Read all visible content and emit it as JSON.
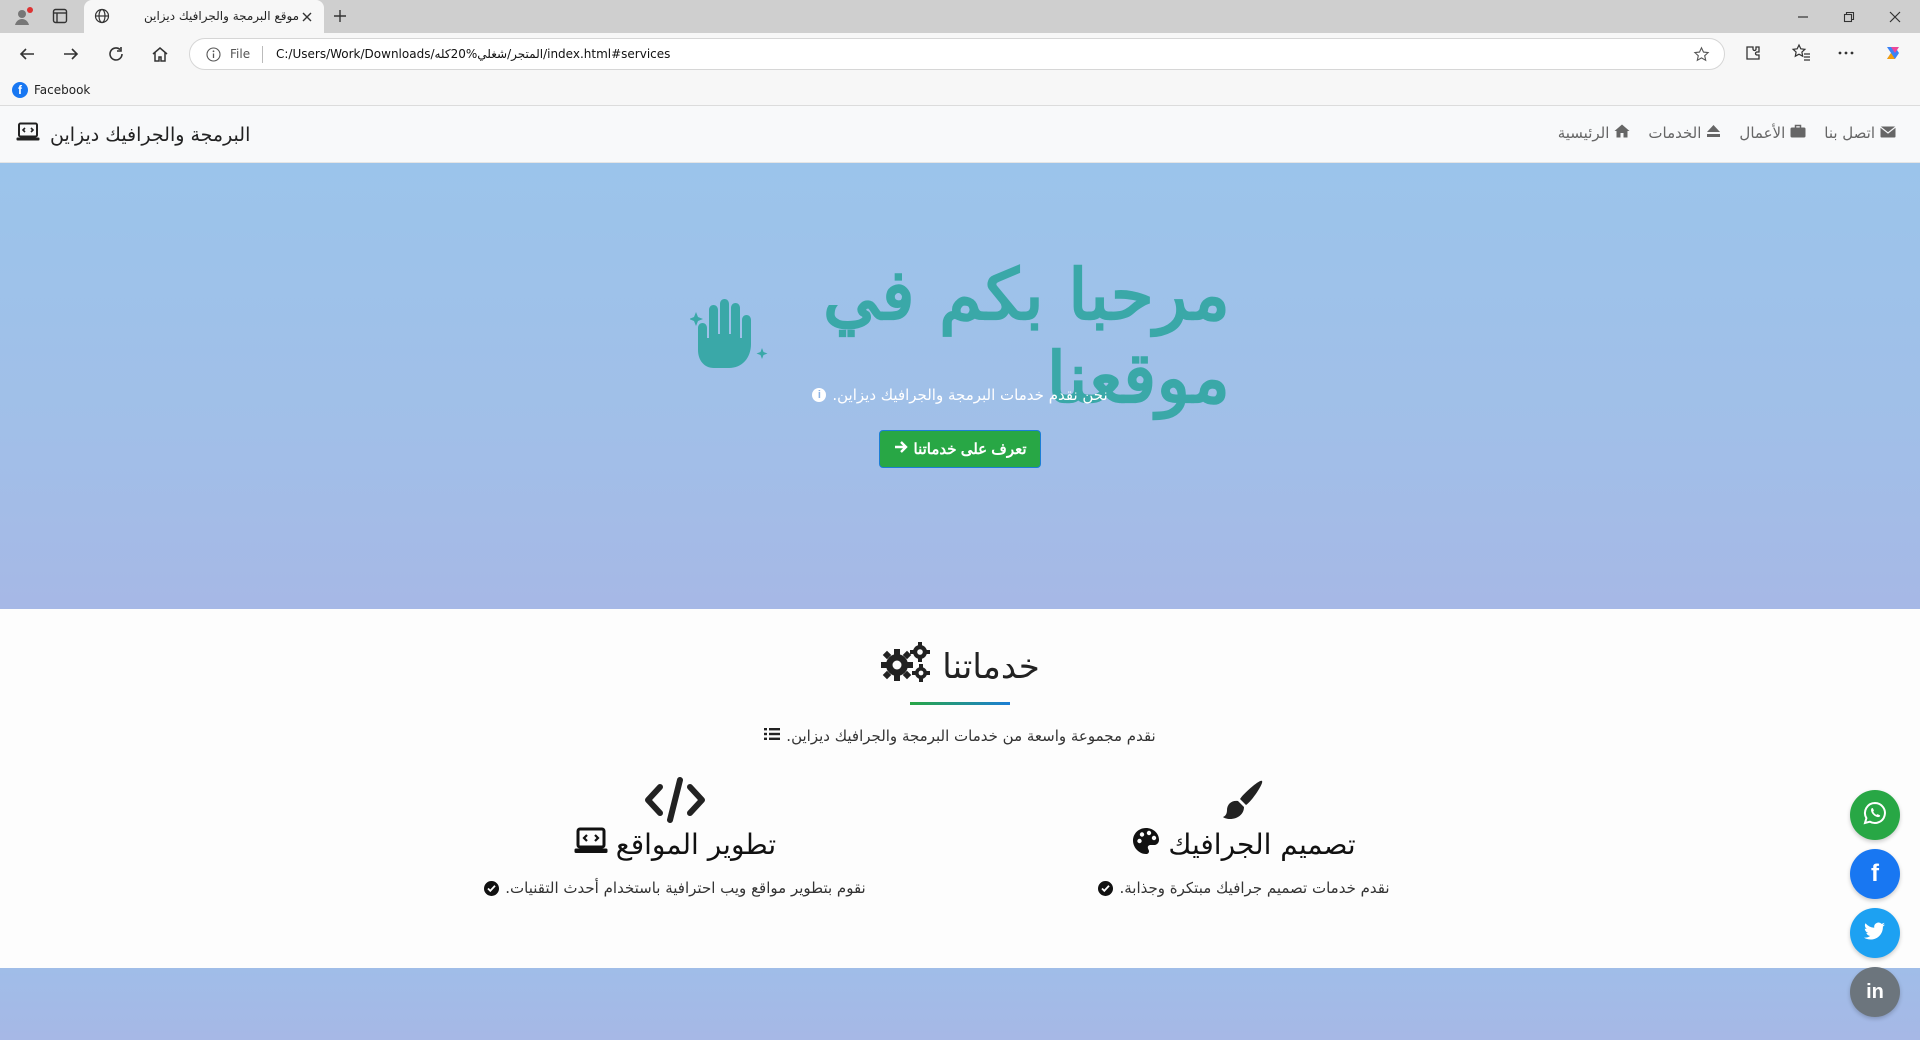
{
  "browser": {
    "tab_title": "موقع البرمجة والجرافيك ديزاين",
    "address_scheme": "File",
    "address_url": "C:/Users/Work/Downloads/المتجر/شغلي%20كله/index.html#services",
    "bookmark_label": "Facebook",
    "bookmark_icon": "facebook-icon"
  },
  "site": {
    "brand": "البرمجة والجرافيك ديزاين",
    "nav": [
      {
        "label": "الرئيسية",
        "icon": "home-icon"
      },
      {
        "label": "الخدمات",
        "icon": "eject-icon"
      },
      {
        "label": "الأعمال",
        "icon": "briefcase-icon"
      },
      {
        "label": "اتصل بنا",
        "icon": "envelope-icon"
      }
    ]
  },
  "hero": {
    "title": "مرحبا بكم في موقعنا",
    "subtitle": "نحن نقدم خدمات البرمجة والجرافيك ديزاين.",
    "button": "تعرف على خدماتنا",
    "title_color": "#3aa8a8",
    "button_color": "#28a745"
  },
  "services": {
    "title": "خدماتنا",
    "description": "نقدم مجموعة واسعة من خدمات البرمجة والجرافيك ديزاين.",
    "cards": [
      {
        "title": "تصميم الجرافيك",
        "text": "نقدم خدمات تصميم جرافيك مبتكرة وجذابة.",
        "big_icon": "paintbrush-icon",
        "title_icon": "palette-icon"
      },
      {
        "title": "تطوير المواقع",
        "text": "نقوم بتطوير مواقع ويب احترافية باستخدام أحدث التقنيات.",
        "big_icon": "code-icon",
        "title_icon": "laptop-code-icon"
      }
    ]
  },
  "social": [
    {
      "name": "whatsapp",
      "glyph": "✆",
      "color": "#28a745"
    },
    {
      "name": "facebook",
      "glyph": "f",
      "color": "#1877f2"
    },
    {
      "name": "twitter",
      "glyph": "🐦",
      "color": "#1da1f2"
    },
    {
      "name": "linkedin",
      "glyph": "in",
      "color": "#6c757d"
    }
  ]
}
